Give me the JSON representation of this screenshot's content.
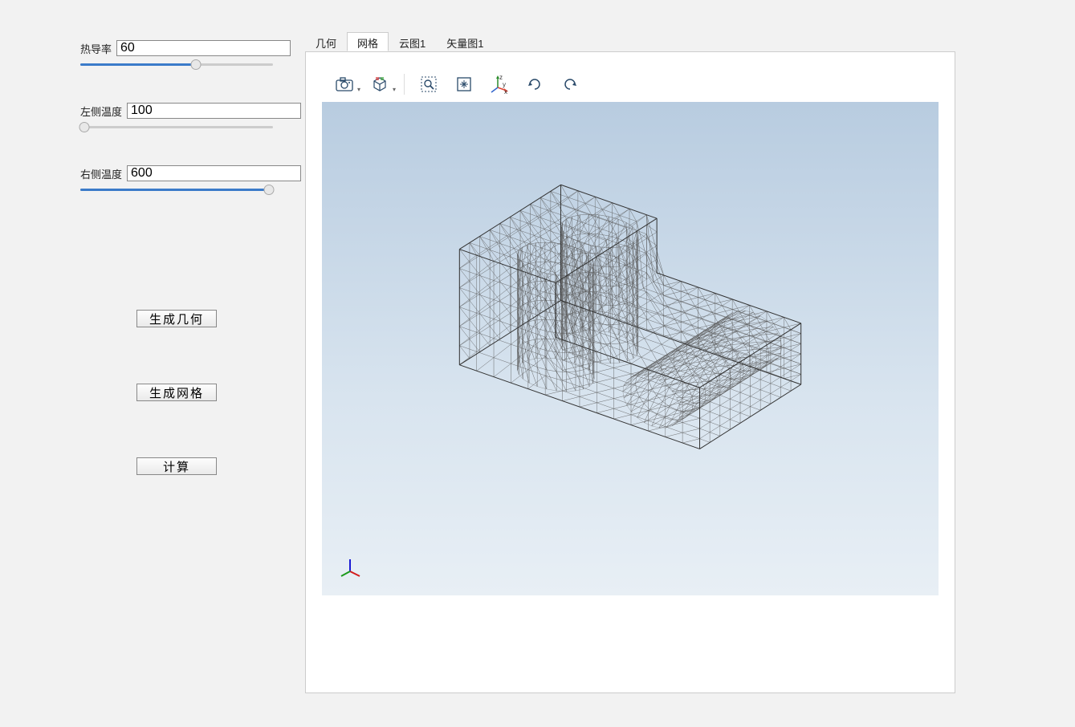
{
  "sidebar": {
    "params": [
      {
        "label": "热导率",
        "value": "60",
        "slider_percent": 60
      },
      {
        "label": "左侧温度",
        "value": "100",
        "slider_percent": 2
      },
      {
        "label": "右侧温度",
        "value": "600",
        "slider_percent": 98
      }
    ],
    "buttons": {
      "gen_geometry": "生成几何",
      "gen_mesh": "生成网格",
      "compute": "计算"
    }
  },
  "tabs": {
    "items": [
      "几何",
      "网格",
      "云图1",
      "矢量图1"
    ],
    "active_index": 1
  },
  "toolbar": {
    "icons": [
      "camera-icon",
      "box-icon",
      "zoom-box-icon",
      "zoom-extents-icon",
      "axes-icon",
      "rotate-cw-icon",
      "rotate-ccw-icon"
    ]
  },
  "axis_labels": {
    "x": "x",
    "y": "y",
    "z": "z"
  }
}
